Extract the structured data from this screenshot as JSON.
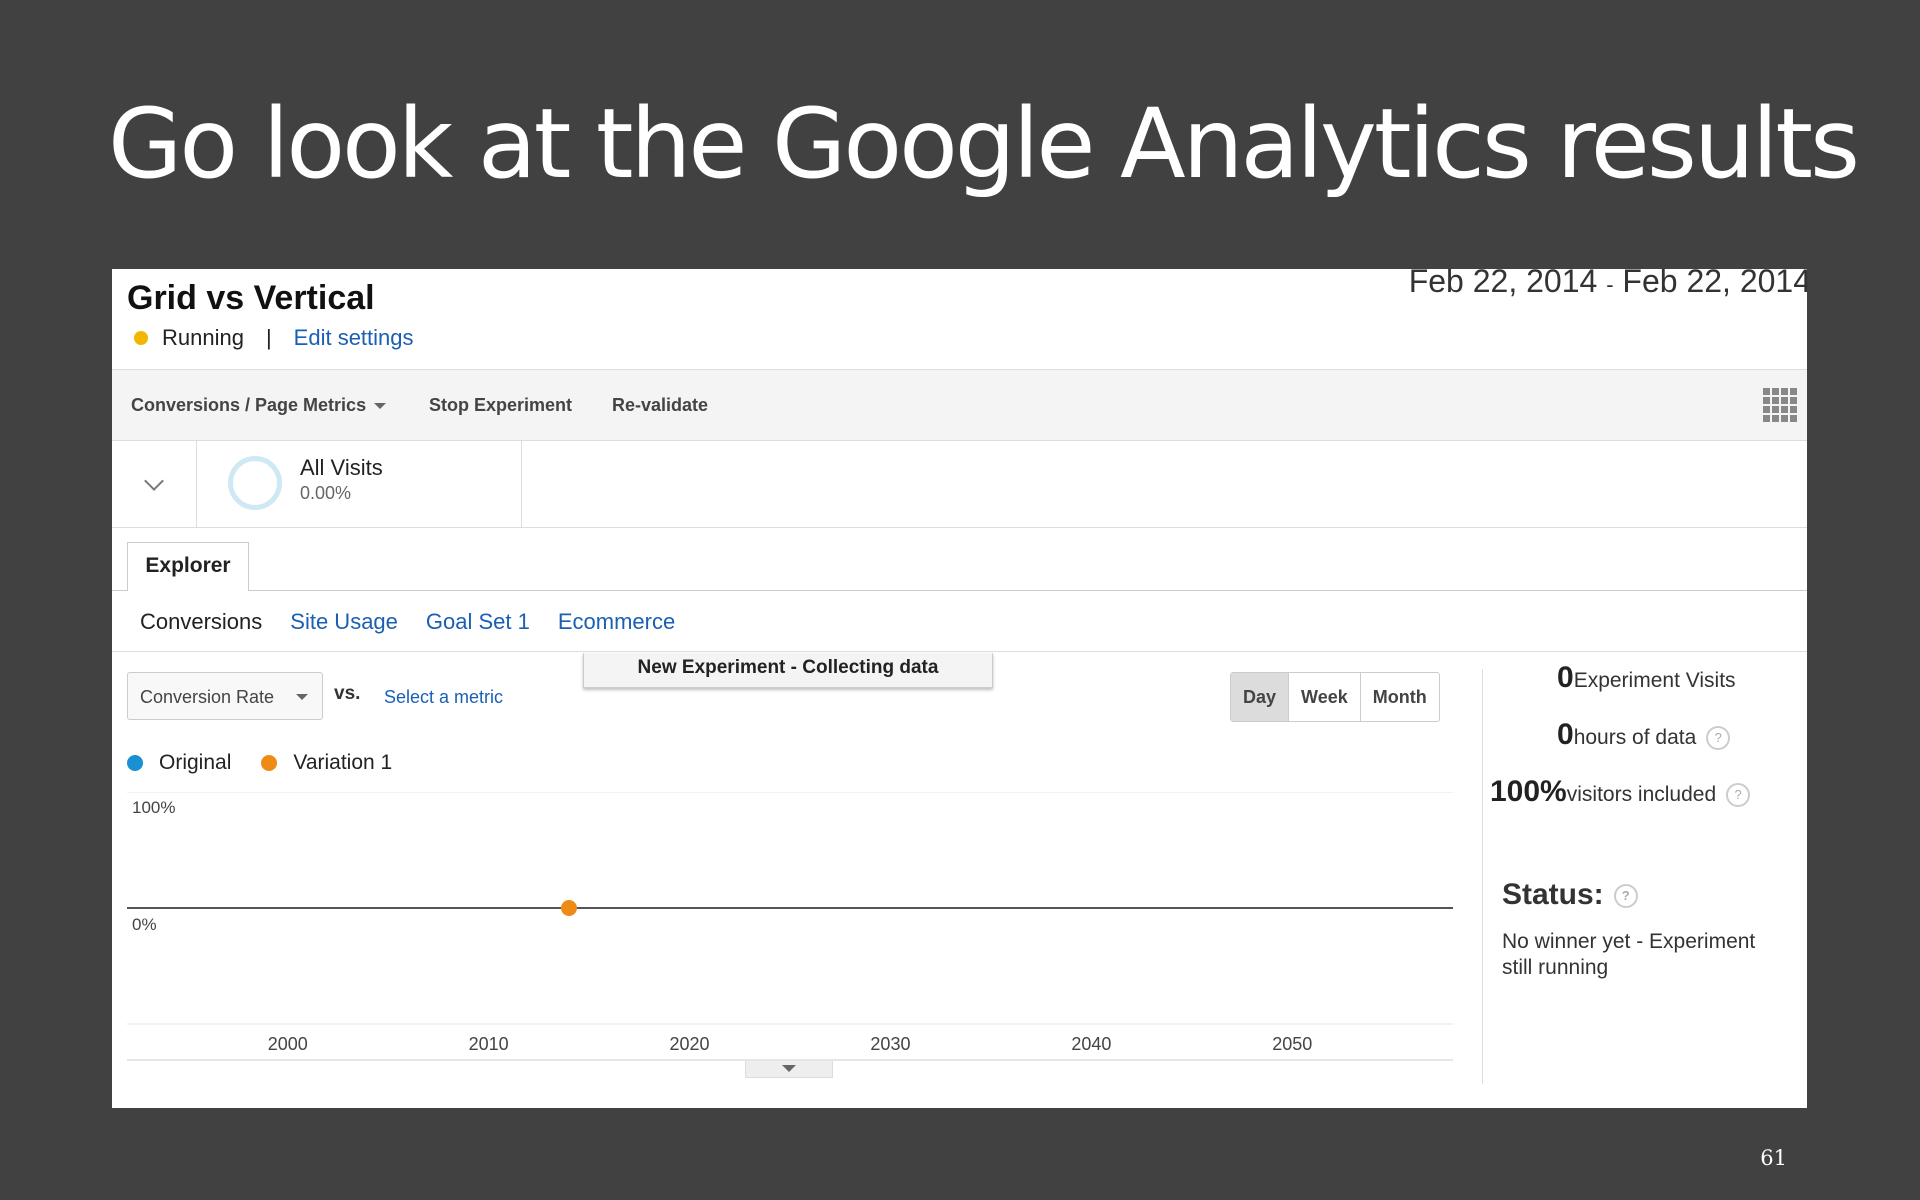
{
  "slide": {
    "title": "Go look at the Google Analytics results",
    "page_number": "61"
  },
  "experiment": {
    "name": "Grid vs Vertical",
    "date_start": "Feb 22, 2014",
    "date_sep": "-",
    "date_end": "Feb 22, 2014",
    "status": "Running",
    "status_color": "#f2b600",
    "separator": "|",
    "edit_label": "Edit settings"
  },
  "toolbar": {
    "report_select": "Conversions / Page Metrics",
    "stop_label": "Stop Experiment",
    "revalidate_label": "Re-validate",
    "apps_icon": "grid-apps-icon"
  },
  "segment": {
    "name": "All Visits",
    "percent": "0.00%"
  },
  "explorer": {
    "tab_label": "Explorer",
    "subtabs": [
      "Conversions",
      "Site Usage",
      "Goal Set 1",
      "Ecommerce"
    ]
  },
  "chart_controls": {
    "banner": "New Experiment - Collecting data",
    "metric": "Conversion Rate",
    "vs": "vs.",
    "select_metric": "Select a metric",
    "ranges": [
      "Day",
      "Week",
      "Month"
    ],
    "selected_range": "Day"
  },
  "legend": [
    {
      "name": "Original",
      "color": "#1a8fd1"
    },
    {
      "name": "Variation 1",
      "color": "#f08a16"
    }
  ],
  "chart_data": {
    "type": "line",
    "y_tick_labels": [
      "100%",
      "0%"
    ],
    "x_tick_labels": [
      "2000",
      "2010",
      "2020",
      "2030",
      "2040",
      "2050"
    ],
    "x_range": [
      1992,
      2058
    ],
    "y_range": [
      -1,
      1
    ],
    "series": [
      {
        "name": "Original",
        "color": "#1a8fd1",
        "points": []
      },
      {
        "name": "Variation 1",
        "color": "#f08a16",
        "points": [
          {
            "x": 2014,
            "y": 0
          }
        ]
      }
    ],
    "grid": true
  },
  "stats": {
    "visits_value": "0",
    "visits_label": "Experiment Visits",
    "hours_value": "0",
    "hours_label": "hours of data",
    "included_value": "100%",
    "included_label": "visitors included",
    "help_glyph": "?"
  },
  "status_panel": {
    "title": "Status:",
    "text": "No winner yet - Experiment still running"
  }
}
